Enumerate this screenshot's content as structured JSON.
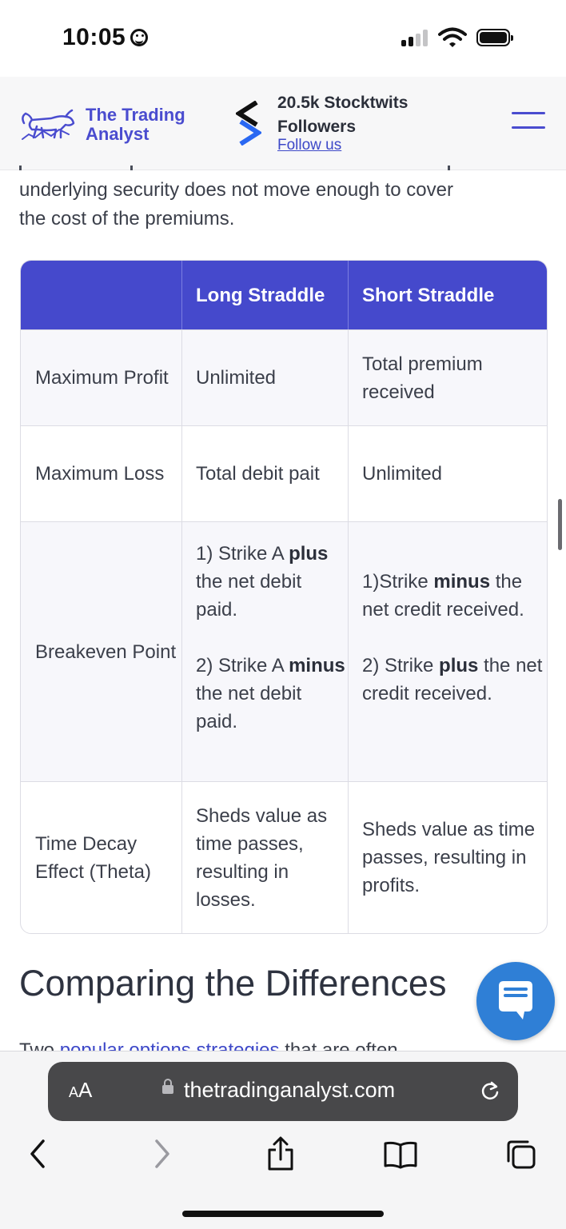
{
  "status_bar": {
    "time": "10:05"
  },
  "header": {
    "logo_text_line1": "The Trading",
    "logo_text_line2": "Analyst",
    "followers_line1": "20.5k Stocktwits",
    "followers_line2": "Followers",
    "follow_link": "Follow us",
    "menu_icon": "hamburger-menu-icon",
    "brand_color": "#4a4ccf"
  },
  "article": {
    "intro_line1": "underlying security does not move enough to cover",
    "intro_line2": "the cost of the premiums.",
    "table": {
      "headers": [
        "",
        "Long Straddle",
        "Short Straddle"
      ],
      "rows": [
        {
          "label": "Maximum Profit",
          "long": "Unlimited",
          "short": "Total premium received"
        },
        {
          "label": "Maximum Loss",
          "long": "Total debit pait",
          "short": "Unlimited"
        },
        {
          "label": "Breakeven Point",
          "long": {
            "p1_a": "1) Strike A ",
            "p1_b": "plus",
            "p1_c": " the net debit paid.",
            "p2_a": "2) Strike A ",
            "p2_b": "minus",
            "p2_c": " the net debit paid."
          },
          "short": {
            "p1_a": "1)Strike ",
            "p1_b": "minus",
            "p1_c": " the net credit received.",
            "p2_a": "2) Strike ",
            "p2_b": "plus",
            "p2_c": " the net credit received."
          }
        },
        {
          "label": "Time Decay Effect (Theta)",
          "long": "Sheds value as time passes, resulting in losses.",
          "short": "Sheds value as time passes, resulting in profits."
        }
      ]
    },
    "section_title": "Comparing the Differences",
    "partial_text_a": "Two ",
    "partial_text_link": "popular options strategies",
    "partial_text_b": " that are often"
  },
  "browser": {
    "aa_label_small": "A",
    "aa_label_big": "A",
    "url": "thetradinganalyst.com",
    "icons": [
      "back-icon",
      "forward-icon",
      "share-icon",
      "bookmarks-icon",
      "tabs-icon",
      "reload-icon",
      "lock-icon"
    ]
  },
  "colors": {
    "table_header": "#4549cc",
    "chat_button": "#2f7fd6",
    "link": "#3d48c8"
  }
}
